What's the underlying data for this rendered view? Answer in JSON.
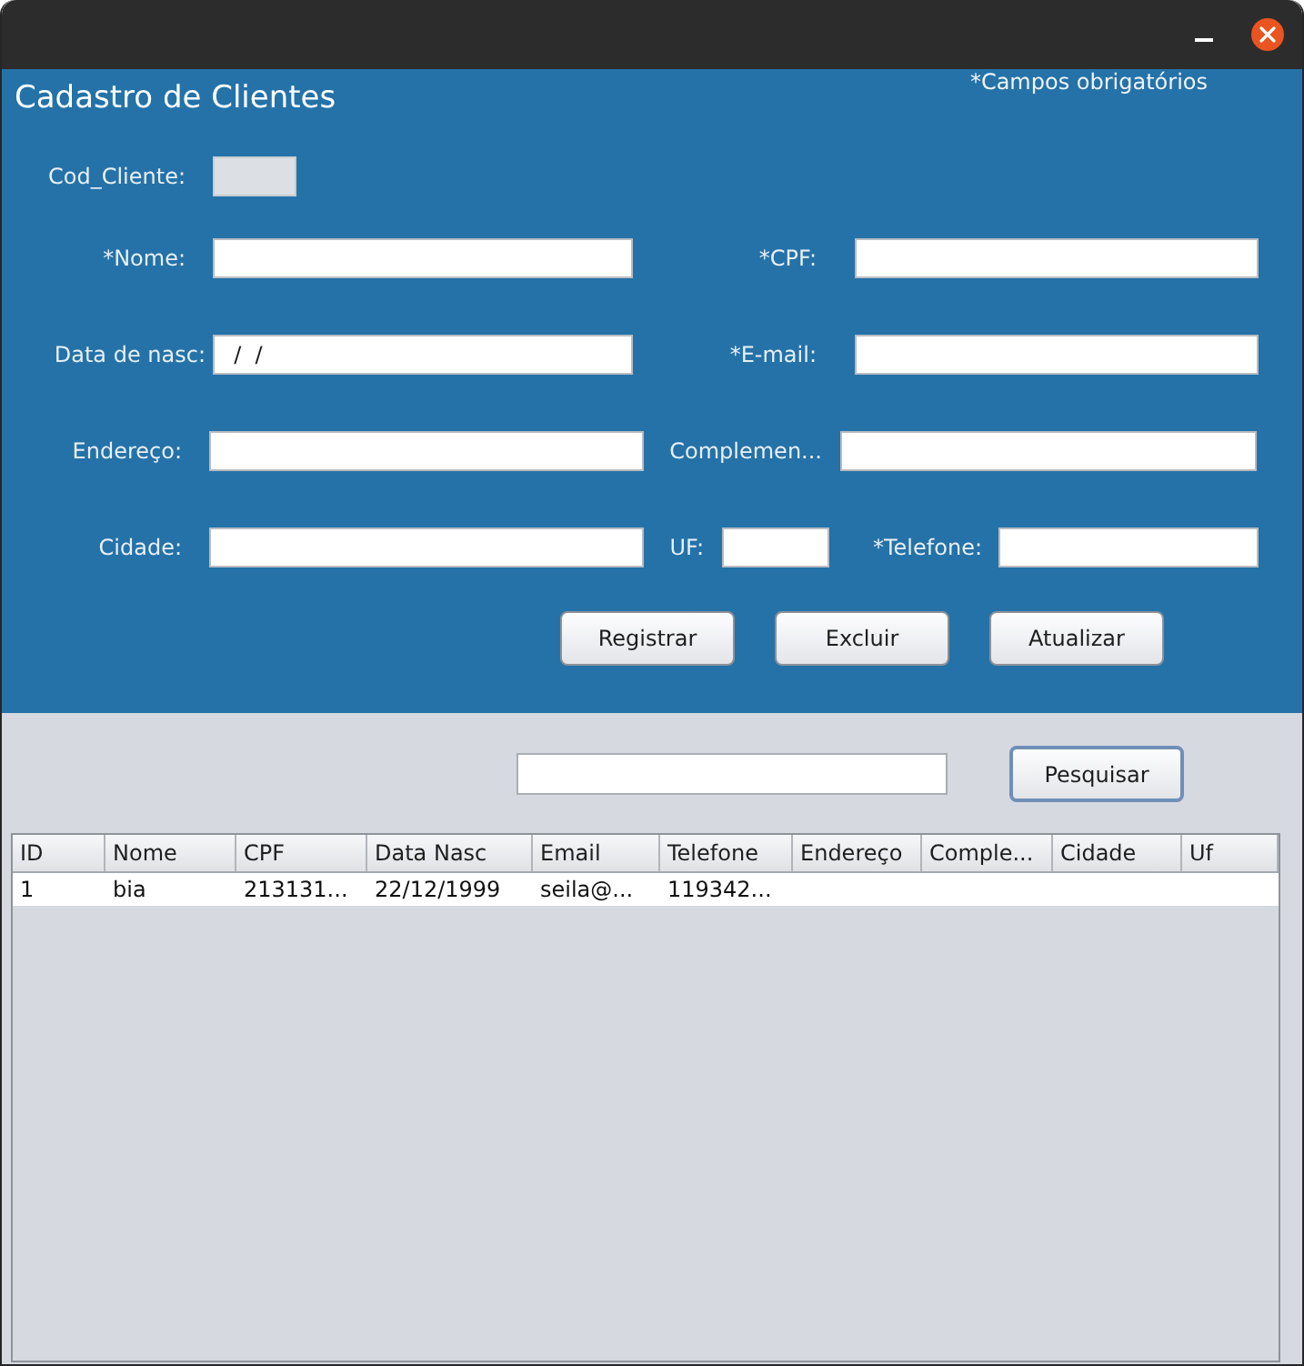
{
  "header": {
    "title": "Cadastro de Clientes",
    "note": "*Campos obrigatórios"
  },
  "form": {
    "rows": [
      [
        {
          "label": "Cod_Cliente:",
          "disabled": true
        }
      ],
      [
        {
          "label": "*Nome:",
          "disabled": false
        },
        {
          "label": "*CPF:",
          "disabled": false
        }
      ],
      [
        {
          "label": "Data de nasc:",
          "value": "  /  /",
          "disabled": false
        },
        {
          "label": "*E-mail:",
          "disabled": false
        }
      ],
      [
        {
          "label": "Endereço:",
          "disabled": false
        },
        {
          "label": "Complemen...",
          "disabled": false
        }
      ],
      [
        {
          "label": "Cidade:",
          "disabled": false
        },
        {
          "label": "UF:",
          "disabled": false
        },
        {
          "label": "*Telefone:",
          "disabled": false
        }
      ]
    ],
    "buttons": [
      "Registrar",
      "Excluir",
      "Atualizar"
    ]
  },
  "search": {
    "button": "Pesquisar",
    "focused": true
  },
  "table": {
    "columns": [
      "ID",
      "Nome",
      "CPF",
      "Data Nasc",
      "Email",
      "Telefone",
      "Endereço",
      "Comple...",
      "Cidade",
      "Uf"
    ],
    "rows": [
      [
        "1",
        "bia",
        "213131...",
        "22/12/1999",
        "seila@...",
        "119342..."
      ]
    ]
  }
}
